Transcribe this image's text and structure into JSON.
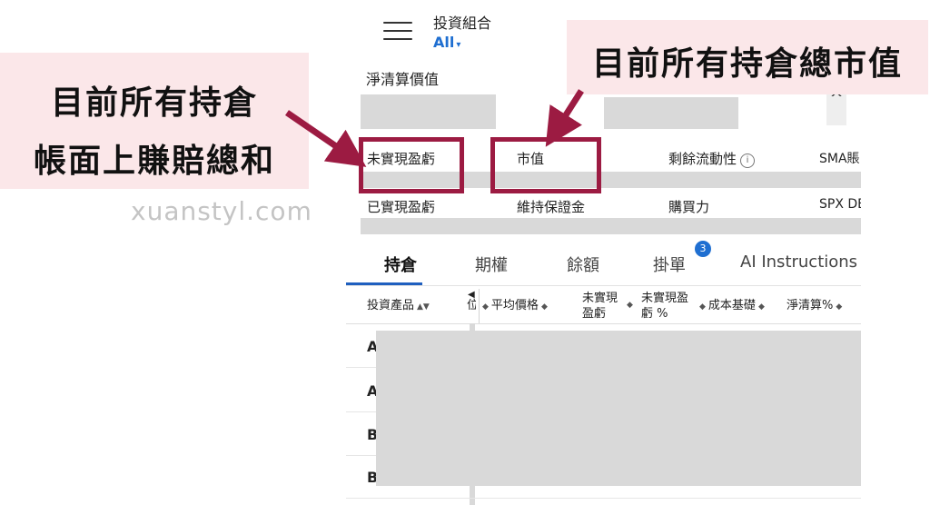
{
  "header": {
    "title": "投資組合",
    "account_selector": "All",
    "net_liquidation_label": "淨清算價值"
  },
  "summary": {
    "row1": [
      "未實現盈虧",
      "市值",
      "剩餘流動性",
      "SMA賬"
    ],
    "row2": [
      "已實現盈虧",
      "維持保證金",
      "購買力",
      "SPX DE"
    ],
    "info_icon": "ⓘ"
  },
  "tabs": [
    {
      "label": "持倉",
      "active": true
    },
    {
      "label": "期權",
      "active": false
    },
    {
      "label": "餘額",
      "active": false
    },
    {
      "label": "掛單",
      "active": false,
      "badge": "3"
    },
    {
      "label": "AI Instructions",
      "active": false
    }
  ],
  "table": {
    "columns": [
      "投資產品",
      "平均價格",
      "未實現盈虧",
      "未實現盈虧 %",
      "成本基礎",
      "淨清算%"
    ],
    "columns_display": {
      "product": "投資產品",
      "cut_fragment": "位",
      "avg_price": "平均價格",
      "unreal_pnl_l1": "未實現",
      "unreal_pnl_l2": "盈虧",
      "unreal_pct_l1": "未實現盈",
      "unreal_pct_l2": "虧 %",
      "cost_basis": "成本基礎",
      "net_liq_pct": "淨清算%"
    },
    "rows": [
      "A",
      "A",
      "B",
      "B"
    ]
  },
  "annotations": {
    "left_line1": "目前所有持倉",
    "left_line2": "帳面上賺賠總和",
    "right_line1": "目前所有持倉總市值",
    "highlight_color": "#9c1b42",
    "note_bg": "#fbe7e9"
  },
  "watermark": "xuanstyl.com",
  "colors": {
    "accent": "#1f6fd1",
    "redaction": "#d9d9d9"
  }
}
